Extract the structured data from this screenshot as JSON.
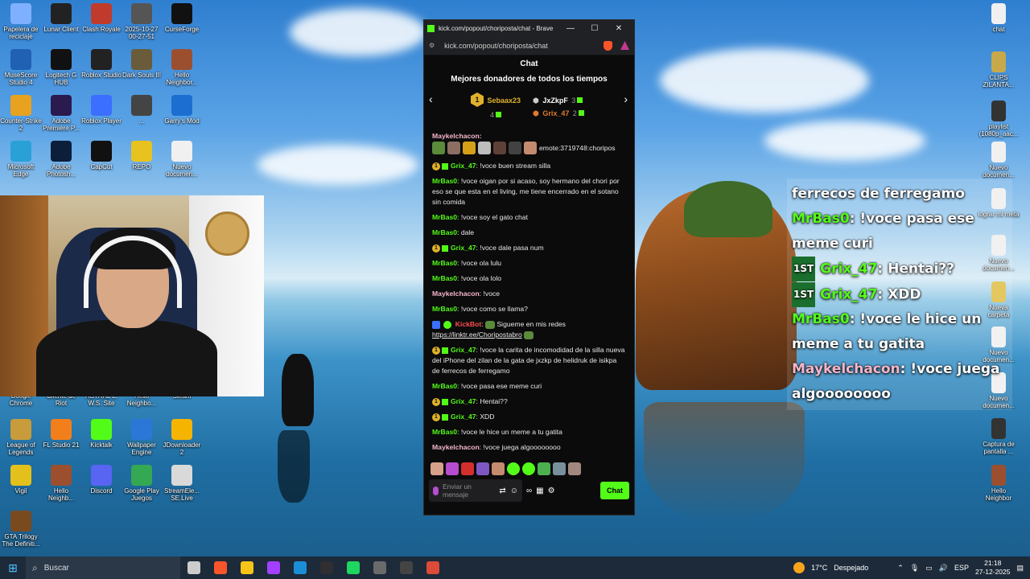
{
  "desktop": {
    "icons_left": [
      {
        "label": "Papelera de reciclaje",
        "color": "#7fb0ff"
      },
      {
        "label": "Lunar Client",
        "color": "#222222"
      },
      {
        "label": "Clash Royale",
        "color": "#c03b2b"
      },
      {
        "label": "2025-10-27 00-27-51",
        "color": "#555555"
      },
      {
        "label": "CurseForge",
        "color": "#111111"
      },
      {
        "label": "MuseScore Studio 4",
        "color": "#2061b3"
      },
      {
        "label": "Logitech G HUB",
        "color": "#111111"
      },
      {
        "label": "Roblox Studio",
        "color": "#222222"
      },
      {
        "label": "Dark Souls III",
        "color": "#6a5b3a"
      },
      {
        "label": "Hello Neighbor...",
        "color": "#9b4f2e"
      },
      {
        "label": "Counter-Strike 2",
        "color": "#e8a21f"
      },
      {
        "label": "Adobe Premiere P...",
        "color": "#2a1a4e"
      },
      {
        "label": "Roblox Player",
        "color": "#3b6fff"
      },
      {
        "label": "...",
        "color": "#444444"
      },
      {
        "label": "Garry's Mod",
        "color": "#1c6fd1"
      },
      {
        "label": "Microsoft Edge",
        "color": "#2aa1d6"
      },
      {
        "label": "Adobe Photosh...",
        "color": "#0b1e3a"
      },
      {
        "label": "CapCut",
        "color": "#111111"
      },
      {
        "label": "REPO",
        "color": "#e8c21f"
      },
      {
        "label": "Nuevo documen...",
        "color": "#f0f0f0"
      },
      {
        "label": "Google Chrome",
        "color": "#dc4a38"
      },
      {
        "label": "Cliente de Riot",
        "color": "#d13639"
      },
      {
        "label": "ASTRAL L. W.S. Site",
        "color": "#666666"
      },
      {
        "label": "Hello Neighbo...",
        "color": "#9b4f2e"
      },
      {
        "label": "Steam",
        "color": "#1b2838"
      },
      {
        "label": "League of Legends",
        "color": "#c89b3c"
      },
      {
        "label": "FL Studio 21",
        "color": "#f27f1b"
      },
      {
        "label": "Kicktalk",
        "color": "#53fc18"
      },
      {
        "label": "Wallpaper Engine",
        "color": "#2b77d8"
      },
      {
        "label": "JDownloader 2",
        "color": "#f5b400"
      },
      {
        "label": "Vigil",
        "color": "#e3c01a"
      },
      {
        "label": "Hello Neighb...",
        "color": "#9b4f2e"
      },
      {
        "label": "Discord",
        "color": "#5865f2"
      },
      {
        "label": "Google Play Juegos",
        "color": "#34a853"
      },
      {
        "label": "StreamEle... SE.Live",
        "color": "#d9d9d9"
      },
      {
        "label": "GTA Trilogy The Definiti...",
        "color": "#7a4a1f"
      }
    ],
    "icons_right": [
      {
        "label": "chat",
        "color": "#f0f0f0"
      },
      {
        "label": "CLIPS ZILANTA...",
        "color": "#c7a94a"
      },
      {
        "label": "playlist (1080p_aac...",
        "color": "#333333"
      },
      {
        "label": "Nuevo documen...",
        "color": "#f0f0f0"
      },
      {
        "label": "lograr mi meta",
        "color": "#f0f0f0"
      },
      {
        "label": "Nuevo documen...",
        "color": "#f0f0f0"
      },
      {
        "label": "Nueva carpeta",
        "color": "#e0c04a"
      },
      {
        "label": "Nuevo documen...",
        "color": "#f0f0f0"
      },
      {
        "label": "Nuevo documen...",
        "color": "#f0f0f0"
      },
      {
        "label": "Captura de pantalla ...",
        "color": "#333333"
      },
      {
        "label": "Hello Neighbor",
        "color": "#9b4f2e"
      }
    ]
  },
  "browser": {
    "title": "kick.com/popout/choriposta/chat - Brave",
    "url": "kick.com/popout/choriposta/chat",
    "chat_header": "Chat",
    "donors_title": "Mejores donadores de todos los tiempos",
    "donors": [
      {
        "rank": "1",
        "name": "Sebaax23",
        "count": "4",
        "color": "#e0b12a"
      },
      {
        "rank": "2",
        "name": "JxZkpF",
        "count": "3",
        "color": "#ffffff"
      },
      {
        "rank": "3",
        "name": "Grix_47",
        "count": "2",
        "color": "#e07a2e"
      }
    ],
    "top_line_user": "Maykelchacon:",
    "top_line_emote_text": "emote:3719748:choripos",
    "messages": [
      {
        "badge": "1",
        "sub": true,
        "user": "Grix_47",
        "user_color": "green",
        "text": "!voce buen stream silla"
      },
      {
        "badge": "",
        "sub": false,
        "user": "MrBas0",
        "user_color": "green",
        "text": "!voce oigan por si acaso, soy hermano del chori por eso se que esta en el living, me tiene encerrado en el sotano sin comida"
      },
      {
        "badge": "",
        "sub": false,
        "user": "MrBas0",
        "user_color": "green",
        "text": "!voce soy el gato chat"
      },
      {
        "badge": "",
        "sub": false,
        "user": "MrBas0",
        "user_color": "green",
        "text": "dale"
      },
      {
        "badge": "1",
        "sub": true,
        "user": "Grix_47",
        "user_color": "green",
        "text": "!voce dale pasa num"
      },
      {
        "badge": "",
        "sub": false,
        "user": "MrBas0",
        "user_color": "green",
        "text": "!voce ola lulu"
      },
      {
        "badge": "",
        "sub": false,
        "user": "MrBas0",
        "user_color": "green",
        "text": "!voce ola lolo"
      },
      {
        "badge": "",
        "sub": false,
        "user": "Maykelchacon",
        "user_color": "pink",
        "text": "!voce"
      },
      {
        "badge": "",
        "sub": false,
        "user": "MrBas0",
        "user_color": "green",
        "text": "!voce como se llama?"
      }
    ],
    "kickbot": {
      "user": "KickBot",
      "text": "Sigueme en mis redes",
      "link": "https://linktr.ee/Choripostabro"
    },
    "messages2": [
      {
        "badge": "1",
        "sub": true,
        "user": "Grix_47",
        "user_color": "green",
        "text": "!voce la carita de incomodidad de la silla nueva del iPhone del zilan de la gata de jxzkp de helidruk de isikpa de ferrecos de ferregamo"
      },
      {
        "badge": "",
        "sub": false,
        "user": "MrBas0",
        "user_color": "green",
        "text": "!voce pasa ese meme curi"
      },
      {
        "badge": "1",
        "sub": true,
        "user": "Grix_47",
        "user_color": "green",
        "text": "Hentai??"
      },
      {
        "badge": "1",
        "sub": true,
        "user": "Grix_47",
        "user_color": "green",
        "text": "XDD"
      },
      {
        "badge": "",
        "sub": false,
        "user": "MrBas0",
        "user_color": "green",
        "text": "!voce le hice un meme a tu gatita"
      },
      {
        "badge": "",
        "sub": false,
        "user": "Maykelchacon",
        "user_color": "pink",
        "text": "!voce juega algoooooooo"
      }
    ],
    "input_placeholder": "Enviar un mensaje",
    "chat_button": "Chat"
  },
  "overlay": {
    "lines": [
      {
        "user": "",
        "user_color": "",
        "badge": "",
        "text": "ferrecos de ferregamo"
      },
      {
        "user": "MrBas0",
        "user_color": "green",
        "badge": "",
        "text": "!voce pasa ese meme curi"
      },
      {
        "user": "Grix_47",
        "user_color": "green",
        "badge": "1ST",
        "text": "Hentai??"
      },
      {
        "user": "Grix_47",
        "user_color": "green",
        "badge": "1ST",
        "text": "XDD"
      },
      {
        "user": "MrBas0",
        "user_color": "green",
        "badge": "",
        "text": "!voce le hice un meme a tu gatita"
      },
      {
        "user": "Maykelchacon",
        "user_color": "pink",
        "badge": "",
        "text": "!voce juega algoooooooo"
      }
    ]
  },
  "taskbar": {
    "search_label": "Buscar",
    "apps": [
      {
        "name": "task-view-icon",
        "color": "#cccccc"
      },
      {
        "name": "brave-icon",
        "color": "#fb542b"
      },
      {
        "name": "file-explorer-icon",
        "color": "#f5c518"
      },
      {
        "name": "messenger-icon",
        "color": "#a33fff"
      },
      {
        "name": "steam-icon",
        "color": "#1b8fd6"
      },
      {
        "name": "obs-icon",
        "color": "#302e31"
      },
      {
        "name": "spotify-icon",
        "color": "#1ed760"
      },
      {
        "name": "app-icon",
        "color": "#6a6a6a"
      },
      {
        "name": "obs-studio-icon",
        "color": "#444444"
      },
      {
        "name": "chrome-icon",
        "color": "#dc4a38"
      }
    ],
    "weather_temp": "17°C",
    "weather_desc": "Despejado",
    "language": "ESP",
    "time": "21:18",
    "date": "27-12-2025"
  }
}
